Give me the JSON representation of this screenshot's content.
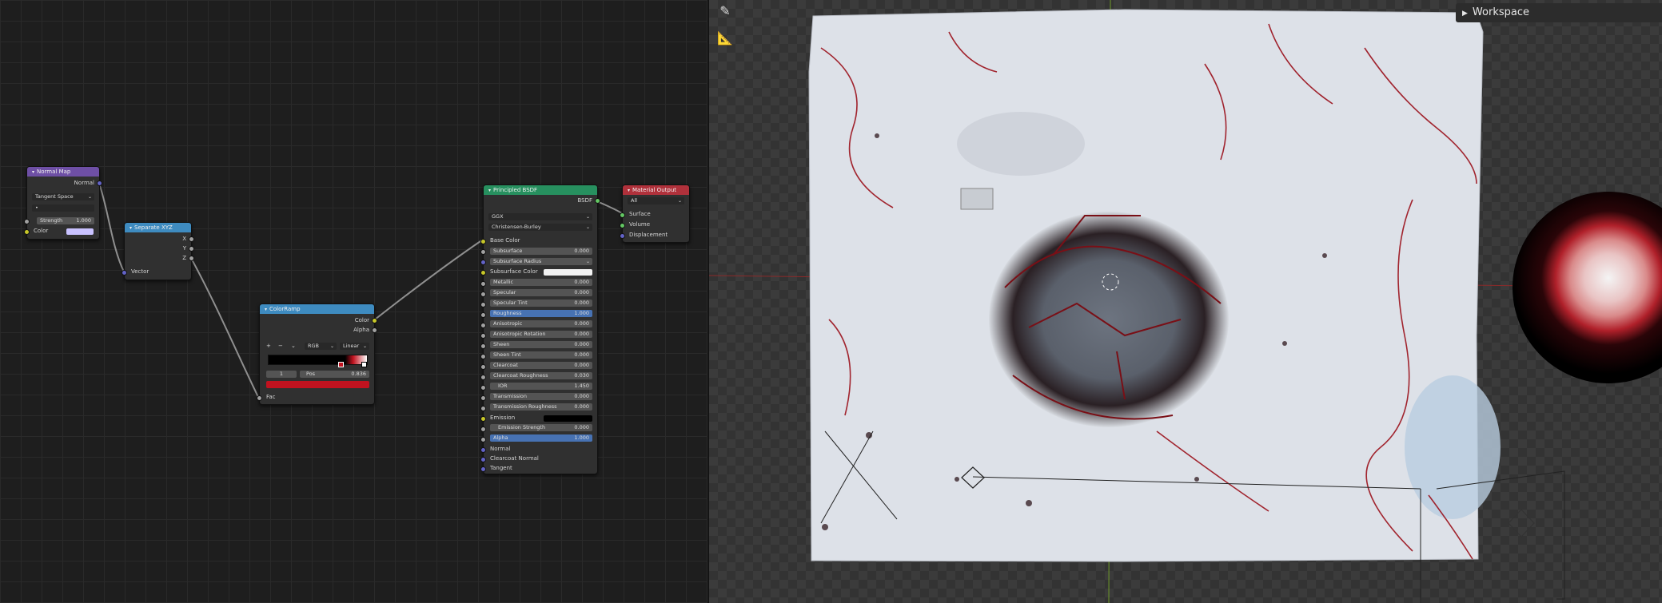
{
  "colors": {
    "node_bg": "#303030",
    "vector_header": "#6e4fa5",
    "converter_header": "#3e8bc0",
    "shader_header": "#27905f",
    "output_header": "#b0313b",
    "socket_yellow": "#c7c729",
    "socket_grey": "#a1a1a1",
    "socket_blue": "#6363c7",
    "socket_green": "#63c763",
    "ramp_red": "#c1121f"
  },
  "nodes": {
    "normal_map": {
      "title": "Normal Map",
      "out_normal": "Normal",
      "space": "Tangent Space",
      "uv": "•",
      "strength_label": "Strength",
      "strength_value": "1.000",
      "color_label": "Color"
    },
    "separate_xyz": {
      "title": "Separate XYZ",
      "out_x": "X",
      "out_y": "Y",
      "out_z": "Z",
      "in_vector": "Vector"
    },
    "color_ramp": {
      "title": "ColorRamp",
      "out_color": "Color",
      "out_alpha": "Alpha",
      "add": "+",
      "remove": "−",
      "mode": "RGB",
      "interpolation": "Linear",
      "index": "1",
      "pos_label": "Pos",
      "pos_value": "0.836",
      "in_fac": "Fac"
    },
    "principled": {
      "title": "Principled BSDF",
      "out_bsdf": "BSDF",
      "distribution": "GGX",
      "subsurface_method": "Christensen-Burley",
      "base_color": "Base Color",
      "subsurface": {
        "label": "Subsurface",
        "value": "0.000"
      },
      "subsurface_radius": "Subsurface Radius",
      "subsurface_color": "Subsurface Color",
      "metallic": {
        "label": "Metallic",
        "value": "0.000"
      },
      "specular": {
        "label": "Specular",
        "value": "0.000"
      },
      "specular_tint": {
        "label": "Specular Tint",
        "value": "0.000"
      },
      "roughness": {
        "label": "Roughness",
        "value": "1.000"
      },
      "anisotropic": {
        "label": "Anisotropic",
        "value": "0.000"
      },
      "anisotropic_rotation": {
        "label": "Anisotropic Rotation",
        "value": "0.000"
      },
      "sheen": {
        "label": "Sheen",
        "value": "0.000"
      },
      "sheen_tint": {
        "label": "Sheen Tint",
        "value": "0.000"
      },
      "clearcoat": {
        "label": "Clearcoat",
        "value": "0.000"
      },
      "clearcoat_roughness": {
        "label": "Clearcoat Roughness",
        "value": "0.030"
      },
      "ior": {
        "label": "IOR",
        "value": "1.450"
      },
      "transmission": {
        "label": "Transmission",
        "value": "0.000"
      },
      "transmission_roughness": {
        "label": "Transmission Roughness",
        "value": "0.000"
      },
      "emission": "Emission",
      "emission_strength": {
        "label": "Emission Strength",
        "value": "0.000"
      },
      "alpha": {
        "label": "Alpha",
        "value": "1.000"
      },
      "normal": "Normal",
      "clearcoat_normal": "Clearcoat Normal",
      "tangent": "Tangent"
    },
    "material_output": {
      "title": "Material Output",
      "target": "All",
      "surface": "Surface",
      "volume": "Volume",
      "displacement": "Displacement"
    }
  },
  "viewport": {
    "tools": [
      "annotate-icon",
      "measure-icon"
    ],
    "workspace_label": "Workspace"
  }
}
